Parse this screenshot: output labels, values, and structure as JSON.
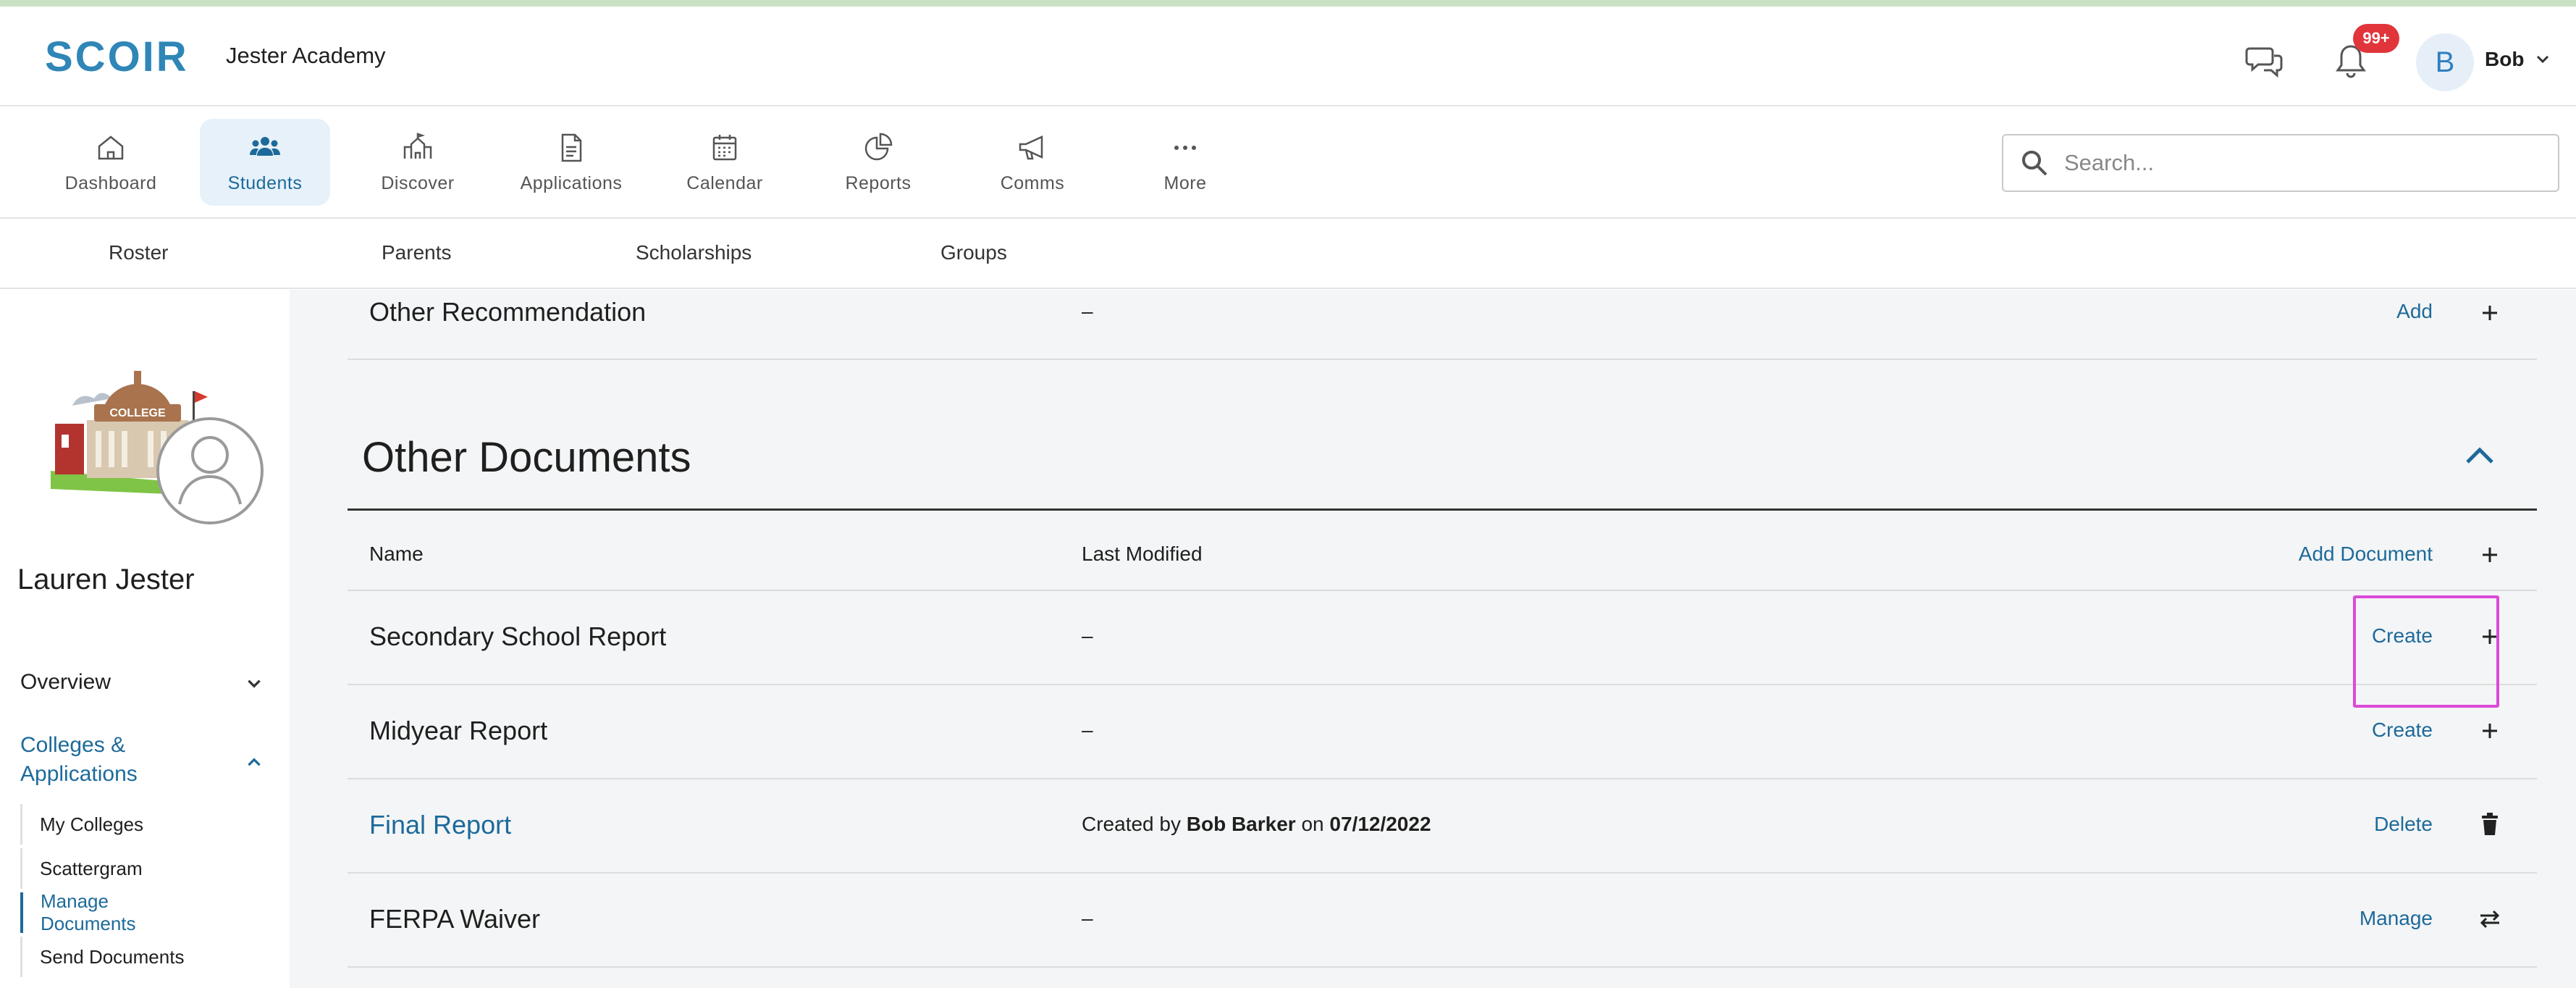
{
  "header": {
    "logo": "SCOIR",
    "school_name": "Jester Academy",
    "notification_badge": "99+",
    "user_initial": "B",
    "user_name": "Bob",
    "icons": [
      "chat-icon",
      "bell-icon",
      "chevron-down-icon"
    ]
  },
  "main_nav": {
    "items": [
      {
        "label": "Dashboard",
        "icon": "home-icon"
      },
      {
        "label": "Students",
        "icon": "users-icon",
        "active": true
      },
      {
        "label": "Discover",
        "icon": "building-icon"
      },
      {
        "label": "Applications",
        "icon": "document-icon"
      },
      {
        "label": "Calendar",
        "icon": "calendar-icon"
      },
      {
        "label": "Reports",
        "icon": "pie-chart-icon"
      },
      {
        "label": "Comms",
        "icon": "megaphone-icon"
      },
      {
        "label": "More",
        "icon": "more-icon"
      }
    ]
  },
  "search": {
    "placeholder": "Search..."
  },
  "sub_nav": {
    "items": [
      "Roster",
      "Parents",
      "Scholarships",
      "Groups"
    ]
  },
  "sidebar": {
    "student_name": "Lauren Jester",
    "overview": "Overview",
    "colleges_line1": "Colleges &",
    "colleges_line2": "Applications",
    "sub_items": [
      "My Colleges",
      "Scattergram",
      "Manage Documents",
      "Send Documents"
    ],
    "active_sub_item": "Manage Documents"
  },
  "content": {
    "other_recommendation": {
      "name": "Other Recommendation",
      "modified": "–",
      "action": "Add"
    },
    "section_title": "Other Documents",
    "table_header": {
      "name": "Name",
      "modified": "Last Modified",
      "action": "Add Document"
    },
    "rows": [
      {
        "name": "Secondary School Report",
        "modified": "–",
        "action": "Create",
        "icon": "plus-icon"
      },
      {
        "name": "Midyear Report",
        "modified": "–",
        "action": "Create",
        "icon": "plus-icon"
      },
      {
        "name": "Final Report",
        "modified_prefix": "Created by ",
        "modified_by": "Bob Barker",
        "modified_mid": " on ",
        "modified_date": "07/12/2022",
        "action": "Delete",
        "icon": "trash-icon"
      },
      {
        "name": "FERPA Waiver",
        "modified": "–",
        "action": "Manage",
        "icon": "swap-icon"
      }
    ]
  },
  "colors": {
    "brand": "#2f86b7",
    "link": "#1d6a9a",
    "badge": "#e0363b",
    "highlight": "#dc4ad8"
  }
}
